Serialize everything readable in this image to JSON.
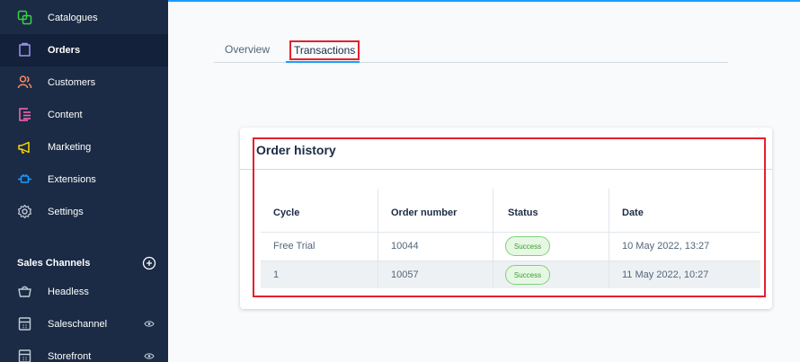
{
  "sidebar": {
    "items": [
      {
        "label": "Catalogues",
        "icon": "catalogues-icon",
        "icon_color": "#37d046"
      },
      {
        "label": "Orders",
        "icon": "orders-icon",
        "icon_color": "#a092f0",
        "active": true
      },
      {
        "label": "Customers",
        "icon": "customers-icon",
        "icon_color": "#f88962"
      },
      {
        "label": "Content",
        "icon": "content-icon",
        "icon_color": "#ff68b4"
      },
      {
        "label": "Marketing",
        "icon": "marketing-icon",
        "icon_color": "#ffd700"
      },
      {
        "label": "Extensions",
        "icon": "extensions-icon",
        "icon_color": "#189eff"
      },
      {
        "label": "Settings",
        "icon": "settings-icon",
        "icon_color": "#9aa8b5"
      }
    ],
    "sales_channels": {
      "title": "Sales Channels",
      "items": [
        {
          "label": "Headless",
          "icon": "headless-icon"
        },
        {
          "label": "Saleschannel",
          "icon": "storefront-icon"
        },
        {
          "label": "Storefront",
          "icon": "storefront-icon"
        }
      ]
    }
  },
  "tabs": [
    "Overview",
    "Transactions"
  ],
  "card": {
    "title": "Order history",
    "columns": [
      "Cycle",
      "Order number",
      "Status",
      "Date"
    ],
    "rows": [
      {
        "cycle": "Free Trial",
        "order_number": "10044",
        "status": "Success",
        "date": "10 May 2022, 13:27"
      },
      {
        "cycle": "1",
        "order_number": "10057",
        "status": "Success",
        "date": "11 May 2022, 10:27"
      }
    ]
  },
  "colors": {
    "accent": "#189eff",
    "sidebar_bg": "#1b2b45",
    "highlight": "#e5202e",
    "success": "#37a12f"
  }
}
